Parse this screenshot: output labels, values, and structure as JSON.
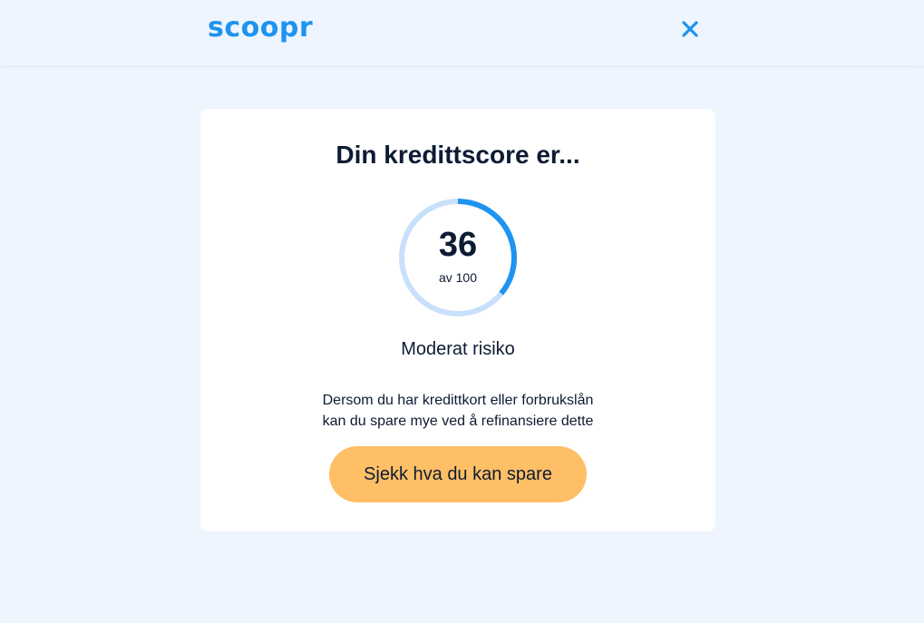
{
  "header": {
    "logo_text": "scoopr",
    "close_icon": "close-icon"
  },
  "card": {
    "title": "Din kredittscore er...",
    "score": {
      "value": "36",
      "max_label": "av 100",
      "fraction": 0.36
    },
    "risk_label": "Moderat risiko",
    "description_line1": "Dersom du har kredittkort eller forbrukslån",
    "description_line2": "kan du spare mye ved å refinansiere dette",
    "cta_label": "Sjekk hva du kan spare"
  },
  "colors": {
    "background": "#eef5fe",
    "accent": "#1e93ef",
    "gauge_track": "#c8e0fb",
    "cta": "#ffbf66",
    "text": "#0d1b33"
  }
}
